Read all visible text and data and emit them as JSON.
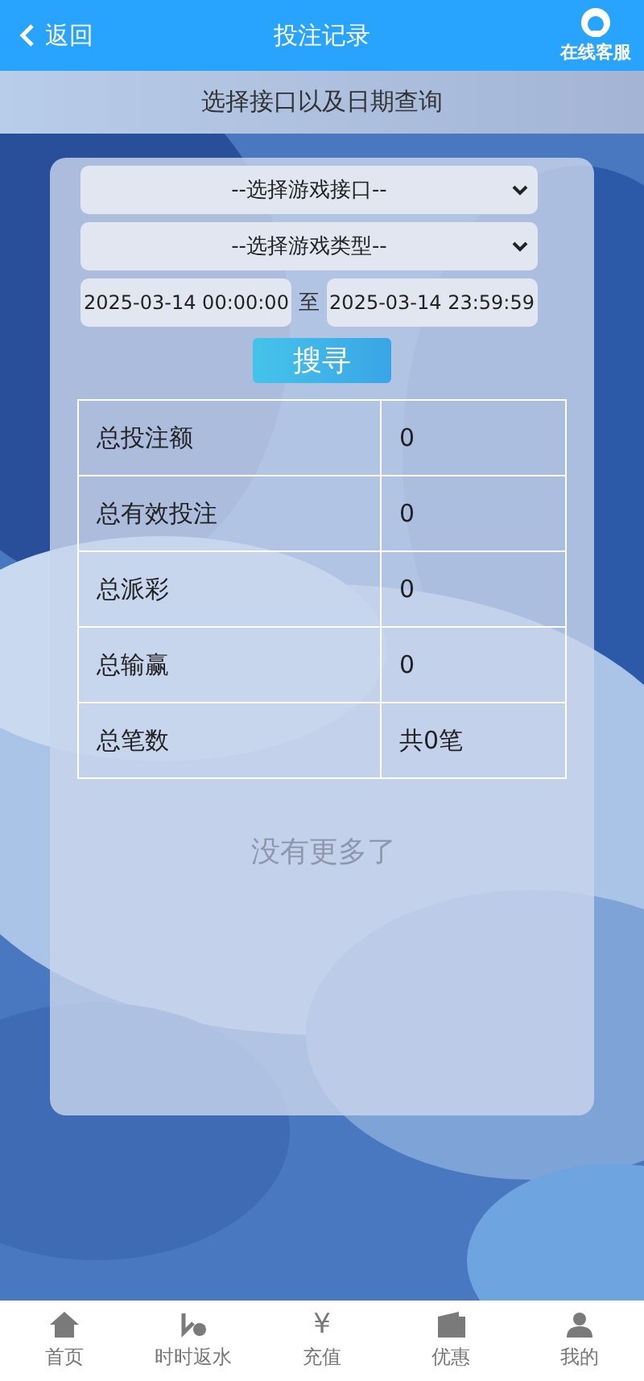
{
  "header": {
    "back": "返回",
    "title": "投注记录",
    "service": "在线客服"
  },
  "subheader": "选择接口以及日期查询",
  "filters": {
    "selects": [
      "--选择游戏接口--",
      "--选择游戏类型--"
    ],
    "start": "2025-03-14 00:00:00",
    "separator": "至",
    "end": "2025-03-14 23:59:59",
    "search": "搜寻"
  },
  "summary": [
    {
      "label": "总投注额",
      "value": "0"
    },
    {
      "label": "总有效投注",
      "value": "0"
    },
    {
      "label": "总派彩",
      "value": "0"
    },
    {
      "label": "总输赢",
      "value": "0"
    },
    {
      "label": "总笔数",
      "value": "共0笔"
    }
  ],
  "empty": "没有更多了",
  "nav": [
    {
      "kind": "home",
      "label": "首页"
    },
    {
      "kind": "rebate",
      "label": "时时返水"
    },
    {
      "kind": "recharge",
      "label": "充值",
      "glyph": "¥"
    },
    {
      "kind": "promo",
      "label": "优惠"
    },
    {
      "kind": "user",
      "label": "我的"
    }
  ]
}
